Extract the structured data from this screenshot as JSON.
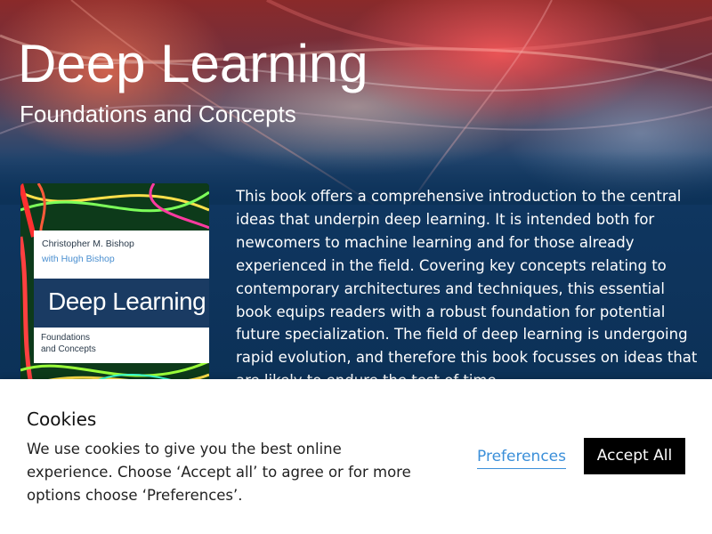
{
  "hero": {
    "title": "Deep Learning",
    "subtitle": "Foundations and Concepts"
  },
  "book_cover": {
    "author": "Christopher M. Bishop",
    "coauthor": "with Hugh Bishop",
    "title": "Deep Learning",
    "subtitle_line1": "Foundations",
    "subtitle_line2": "and Concepts"
  },
  "description": "This book offers a comprehensive introduction to the central ideas that underpin deep learning. It is intended both for newcomers to machine learning and for those already experienced in the field. Covering key concepts relating to contemporary architectures and techniques, this essential book equips readers with a robust foundation for potential future specialization. The field of deep learning is undergoing rapid evolution, and therefore this book focusses on ideas that are likely to endure the test of time.",
  "cookie_banner": {
    "title": "Cookies",
    "text": "We use cookies to give you the best online experience. Choose ‘Accept all’ to agree or for more options choose ‘Preferences’.",
    "preferences_label": "Preferences",
    "accept_label": "Accept All"
  },
  "colors": {
    "page_background": "#0c3157",
    "link": "#3b8fd9",
    "accept_button": "#000000"
  }
}
